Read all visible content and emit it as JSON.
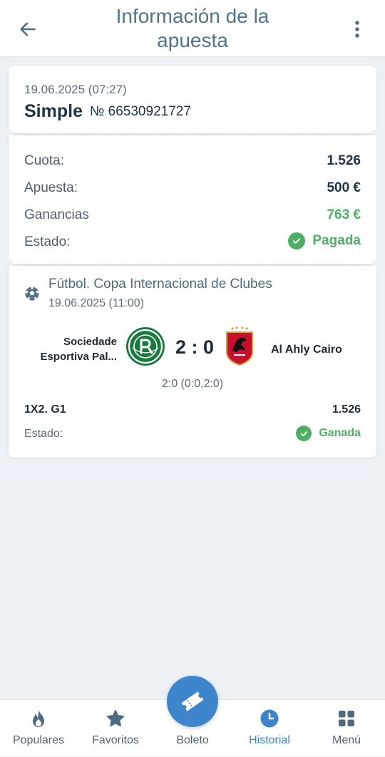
{
  "header": {
    "title": "Información de la apuesta",
    "back_icon": "arrow-left-icon",
    "menu_icon": "more-vertical-icon"
  },
  "bet": {
    "datetime": "19.06.2025 (07:27)",
    "type": "Simple",
    "number": "№ 66530921727"
  },
  "summary": {
    "odds_label": "Cuota:",
    "odds_value": "1.526",
    "stake_label": "Apuesta:",
    "stake_value": "500 €",
    "winnings_label": "Ganancias",
    "winnings_value": "763 €",
    "status_label": "Estado:",
    "status_value": "Pagada"
  },
  "event": {
    "sport_icon": "soccer-ball-icon",
    "title": "Fútbol. Copa Internacional de Clubes",
    "datetime": "19.06.2025 (11:00)",
    "home_team": "Sociedade Esportiva Pal...",
    "away_team": "Al Ahly Cairo",
    "score": "2 : 0",
    "score_detail": "2:0 (0:0,2:0)",
    "market": "1X2. G1",
    "market_odds": "1.526",
    "status_label": "Estado:",
    "status_value": "Ganada"
  },
  "nav": {
    "items": [
      {
        "label": "Populares",
        "icon": "flame-icon"
      },
      {
        "label": "Favoritos",
        "icon": "star-icon"
      },
      {
        "label": "Boleto",
        "icon": "ticket-icon"
      },
      {
        "label": "Historial",
        "icon": "clock-icon"
      },
      {
        "label": "Menú",
        "icon": "grid-icon"
      }
    ],
    "active_index": 3
  },
  "colors": {
    "accent": "#3e86cc",
    "title": "#51748d",
    "success": "#4caf65",
    "background": "#edf0f5"
  }
}
